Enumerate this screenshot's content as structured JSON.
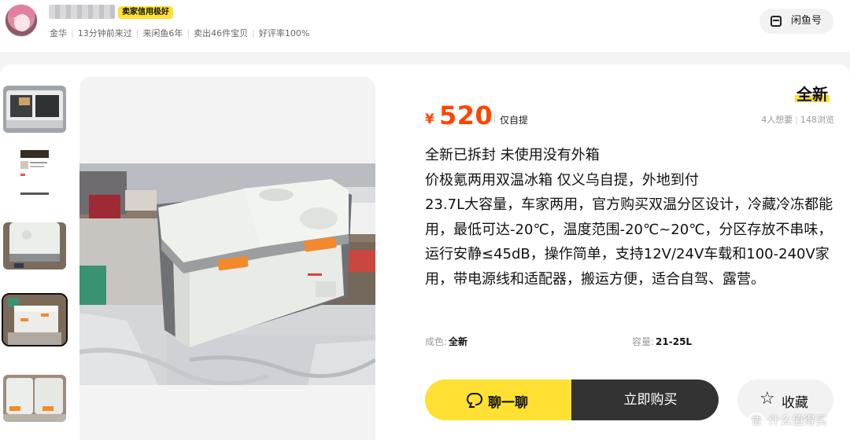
{
  "seller": {
    "badge": "卖家信用极好",
    "meta": [
      "金华",
      "13分钟前来过",
      "来闲鱼6年",
      "卖出46件宝贝",
      "好评率100%"
    ],
    "xianyu_button": "闲鱼号"
  },
  "listing": {
    "condition": "全新",
    "currency": "¥",
    "price": "520",
    "delivery": "仅自提",
    "wants": "4人想要",
    "views": "148浏览",
    "description": "全新已拆封 未使用没有外箱\n价极氪两用双温冰箱 仅义乌自提，外地到付\n23.7L大容量，车家两用，官方购买双温分区设计，冷藏冷冻都能用，最低可达-20℃，温度范围-20℃~20℃，分区存放不串味，运行安静≤45dB，操作简单，支持12V/24V车载和100-240V家用，带电源线和适配器，搬运方便，适合自驾、露营。",
    "attributes": [
      {
        "key": "成色:",
        "value": "全新"
      },
      {
        "key": "容量:",
        "value": "21-25L"
      }
    ]
  },
  "actions": {
    "chat": "聊一聊",
    "buy": "立即购买",
    "favorite": "收藏"
  },
  "watermark": {
    "icon_text": "值",
    "text": "什么值得买"
  },
  "colors": {
    "price": "#ff4400",
    "accent_yellow": "#ffe033",
    "buy_button": "#333333"
  }
}
